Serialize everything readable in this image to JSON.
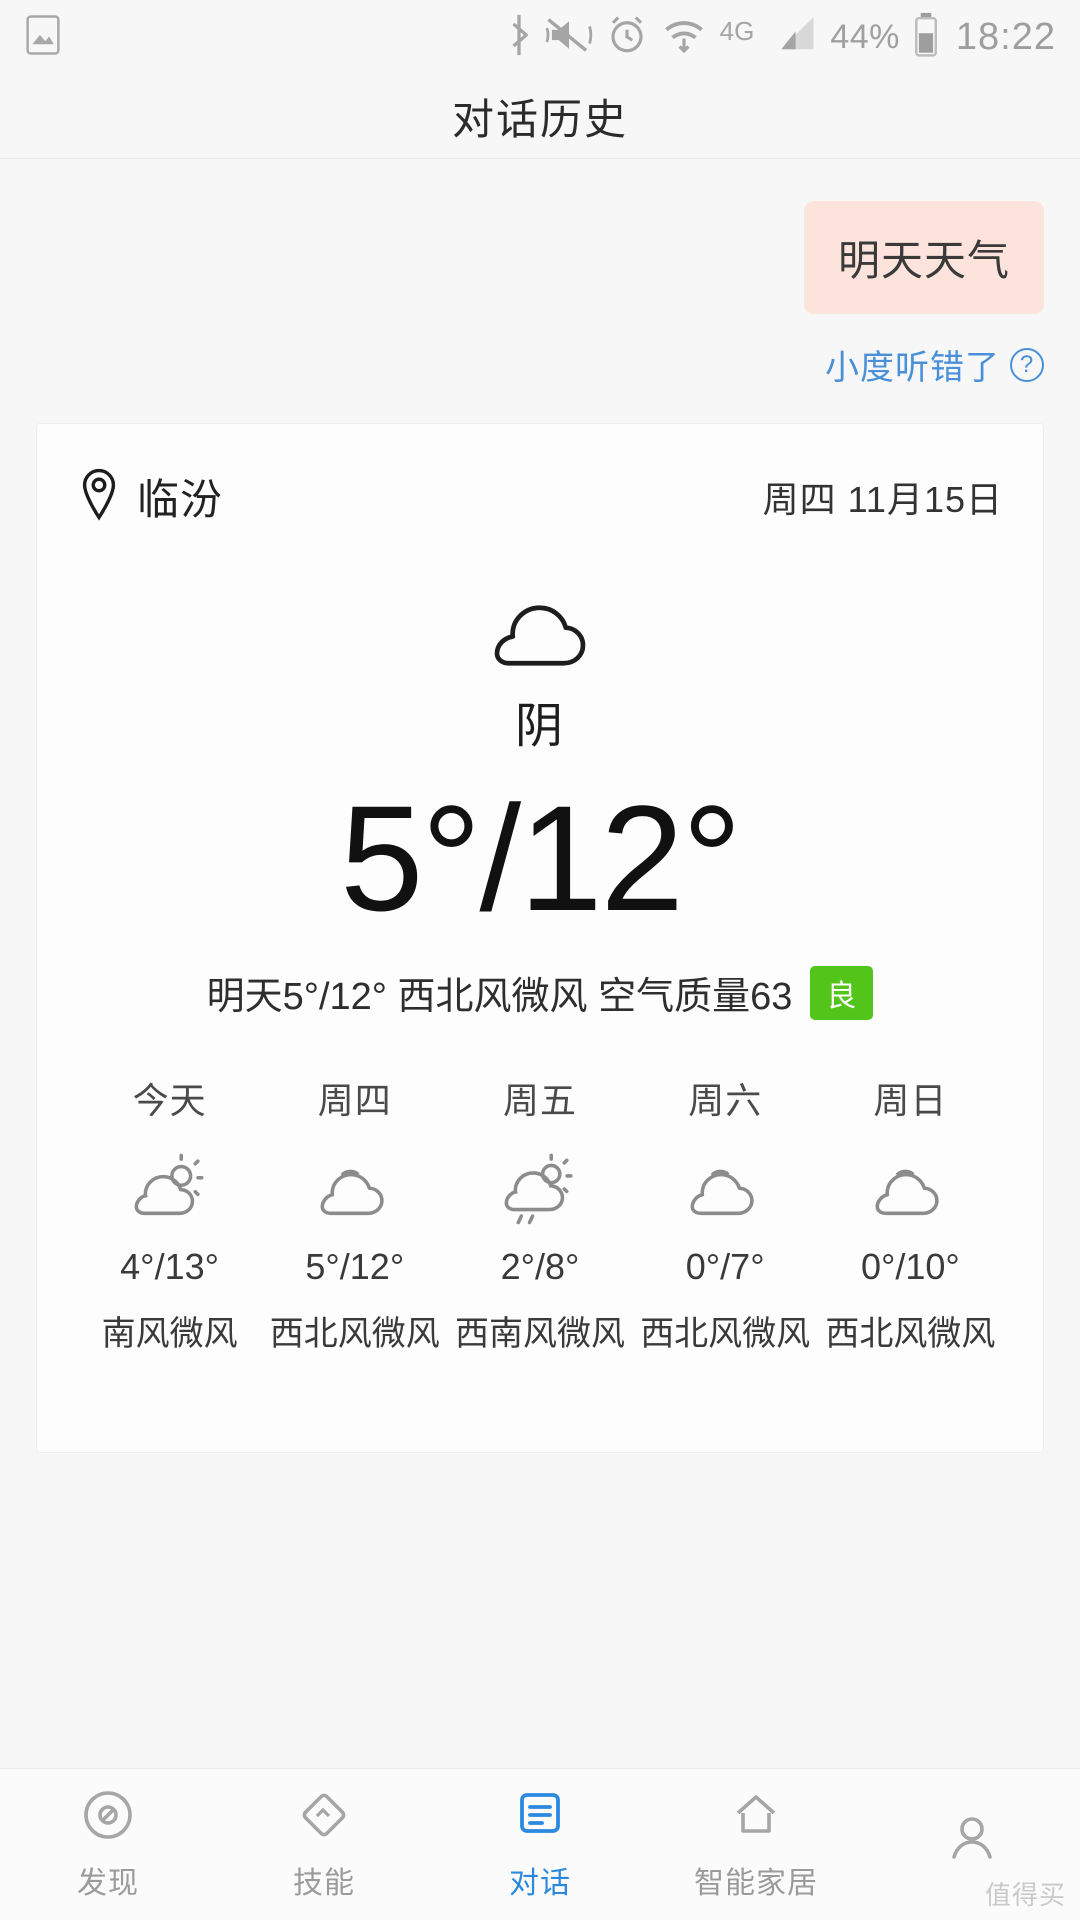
{
  "status_bar": {
    "left_icons": [
      "image-icon"
    ],
    "right_icons": [
      "bluetooth-icon",
      "mute-vibrate-icon",
      "alarm-icon",
      "wifi-icon",
      "signal-icon",
      "battery-icon"
    ],
    "network": "4G",
    "battery_percent": "44%",
    "time": "18:22"
  },
  "header": {
    "title": "对话历史"
  },
  "conversation": {
    "user_message": "明天天气",
    "misheard_link": "小度听错了",
    "misheard_icon": "question-mark-circle-icon"
  },
  "weather_card": {
    "location": "临汾",
    "location_icon": "location-pin-icon",
    "date": "周四 11月15日",
    "condition": "阴",
    "condition_icon": "cloudy-icon",
    "temperature": "5°/12°",
    "detail": "明天5°/12° 西北风微风 空气质量63",
    "aqi_value": "63",
    "aqi_label": "良",
    "aqi_color": "#52c41a",
    "forecast": [
      {
        "day": "今天",
        "icon": "sun-cloud-icon",
        "temp": "4°/13°",
        "wind": "南风微风"
      },
      {
        "day": "周四",
        "icon": "cloudy-icon",
        "temp": "5°/12°",
        "wind": "西北风微风"
      },
      {
        "day": "周五",
        "icon": "sun-cloud-rain-icon",
        "temp": "2°/8°",
        "wind": "西南风微风"
      },
      {
        "day": "周六",
        "icon": "cloudy-icon",
        "temp": "0°/7°",
        "wind": "西北风微风"
      },
      {
        "day": "周日",
        "icon": "cloudy-icon",
        "temp": "0°/10°",
        "wind": "西北风微风"
      }
    ]
  },
  "bottom_nav": {
    "items": [
      {
        "label": "发现",
        "icon": "compass-icon",
        "active": false
      },
      {
        "label": "技能",
        "icon": "diamond-icon",
        "active": false
      },
      {
        "label": "对话",
        "icon": "chat-lines-icon",
        "active": true
      },
      {
        "label": "智能家居",
        "icon": "home-icon",
        "active": false
      },
      {
        "label": "",
        "icon": "profile-icon",
        "active": false
      }
    ],
    "active_color": "#2b8ae0"
  },
  "watermark": "值得买"
}
